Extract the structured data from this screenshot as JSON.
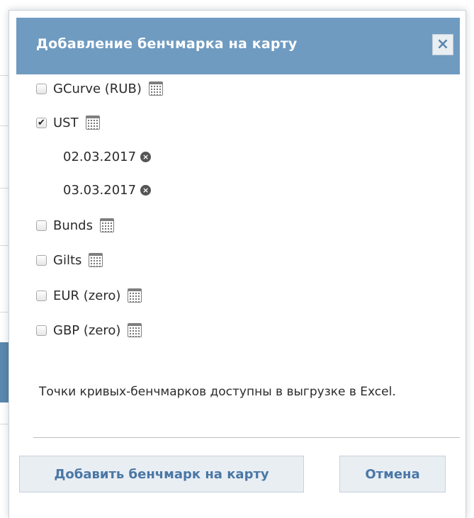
{
  "dialog": {
    "title": "Добавление бенчмарка на карту",
    "close_label": "×"
  },
  "benchmarks": [
    {
      "label": "GCurve (RUB)",
      "checked": false
    },
    {
      "label": "UST",
      "checked": true,
      "dates": [
        "02.03.2017",
        "03.03.2017"
      ]
    },
    {
      "label": "Bunds",
      "checked": false
    },
    {
      "label": "Gilts",
      "checked": false
    },
    {
      "label": "EUR (zero)",
      "checked": false
    },
    {
      "label": "GBP (zero)",
      "checked": false
    }
  ],
  "note": "Точки кривых-бенчмарков доступны в выгрузке в Excel.",
  "buttons": {
    "add": "Добавить бенчмарк на карту",
    "cancel": "Отмена"
  },
  "icons": {
    "checkbox_checked": "✔",
    "remove_date": "×",
    "calendar": "calendar-icon"
  },
  "colors": {
    "header_bg": "#6f9bc1",
    "button_bg": "#e9eef3",
    "button_text": "#4a77a6"
  }
}
